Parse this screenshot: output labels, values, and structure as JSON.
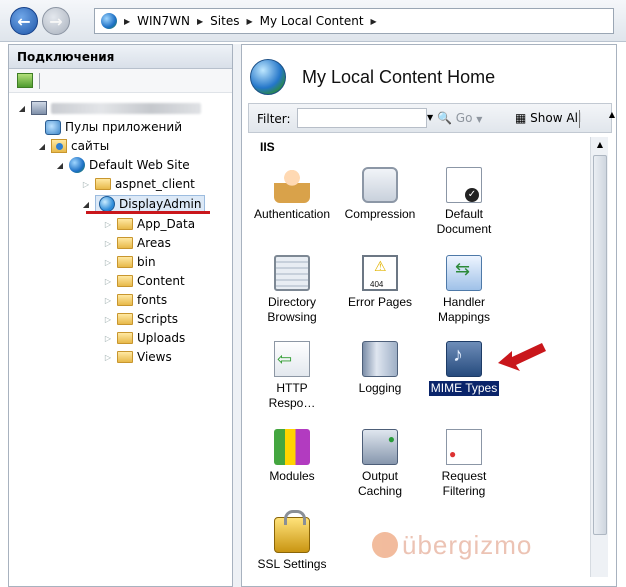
{
  "breadcrumb": {
    "items": [
      "WIN7WN",
      "Sites",
      "My Local Content"
    ]
  },
  "connections": {
    "title": "Подключения",
    "tree": {
      "app_pools": "Пулы приложений",
      "sites": "сайты",
      "default_site": "Default Web Site",
      "aspnet_client": "aspnet_client",
      "display_admin": "DisplayAdmin",
      "folders": [
        "App_Data",
        "Areas",
        "bin",
        "Content",
        "fonts",
        "Scripts",
        "Uploads",
        "Views"
      ]
    }
  },
  "main": {
    "title": "My Local Content Home",
    "filter": {
      "label": "Filter:",
      "value": "",
      "go_label": "Go",
      "show_all_label": "Show All"
    },
    "group": "IIS",
    "features": [
      {
        "label": "Authentication",
        "icon": "authentication-icon"
      },
      {
        "label": "Compression",
        "icon": "compression-icon"
      },
      {
        "label": "Default Document",
        "icon": "default-document-icon"
      },
      {
        "label": "Directory Browsing",
        "icon": "directory-browsing-icon"
      },
      {
        "label": "Error Pages",
        "icon": "error-pages-icon"
      },
      {
        "label": "Handler Mappings",
        "icon": "handler-mappings-icon"
      },
      {
        "label": "HTTP Respo…",
        "icon": "http-response-headers-icon"
      },
      {
        "label": "Logging",
        "icon": "logging-icon"
      },
      {
        "label": "MIME Types",
        "icon": "mime-types-icon",
        "selected": true
      },
      {
        "label": "Modules",
        "icon": "modules-icon"
      },
      {
        "label": "Output Caching",
        "icon": "output-caching-icon"
      },
      {
        "label": "Request Filtering",
        "icon": "request-filtering-icon"
      },
      {
        "label": "SSL Settings",
        "icon": "ssl-settings-icon"
      }
    ]
  },
  "watermark": "übergizmo",
  "colors": {
    "selection": "#0a246a",
    "annotation_red": "#c9161b"
  }
}
